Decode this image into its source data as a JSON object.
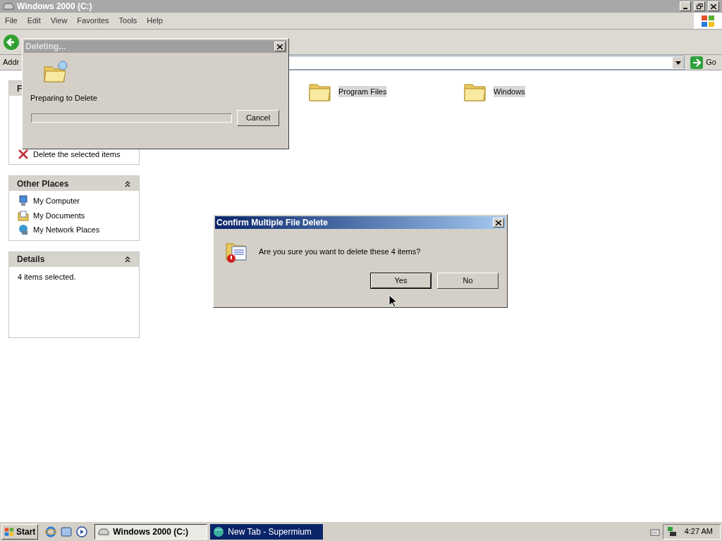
{
  "explorer": {
    "title": "Windows 2000 (C:)",
    "active": false,
    "menu": [
      "File",
      "Edit",
      "View",
      "Favorites",
      "Tools",
      "Help"
    ],
    "address_label": "Addr",
    "go_label": "Go",
    "panels": [
      {
        "title": "F",
        "items": [
          {
            "label": "Delete the selected items",
            "kind": "delete"
          }
        ]
      },
      {
        "title": "Other Places",
        "items": [
          {
            "label": "My Computer",
            "kind": "computer"
          },
          {
            "label": "My Documents",
            "kind": "documents"
          },
          {
            "label": "My Network Places",
            "kind": "network"
          }
        ]
      },
      {
        "title": "Details",
        "text": "4 items selected."
      }
    ],
    "folders": [
      {
        "name": "Program Files",
        "selected": true
      },
      {
        "name": "Windows",
        "selected": true
      }
    ]
  },
  "progress_dialog": {
    "title": "Deleting...",
    "active": false,
    "status": "Preparing to Delete",
    "level": 0,
    "cancel": "Cancel"
  },
  "confirm_dialog": {
    "title": "Confirm Multiple File Delete",
    "active": true,
    "message": "Are you sure you want to delete these 4 items?",
    "buttons": [
      {
        "label": "Yes",
        "default": true
      },
      {
        "label": "No",
        "default": false
      }
    ]
  },
  "taskbar": {
    "start": "Start",
    "tasks": [
      {
        "label": "Windows 2000 (C:)",
        "selected": true,
        "flashing": false,
        "kind": "drive"
      },
      {
        "label": "New Tab - Supermium",
        "selected": false,
        "flashing": true,
        "kind": "browser"
      }
    ],
    "clock": "4:27 AM"
  }
}
